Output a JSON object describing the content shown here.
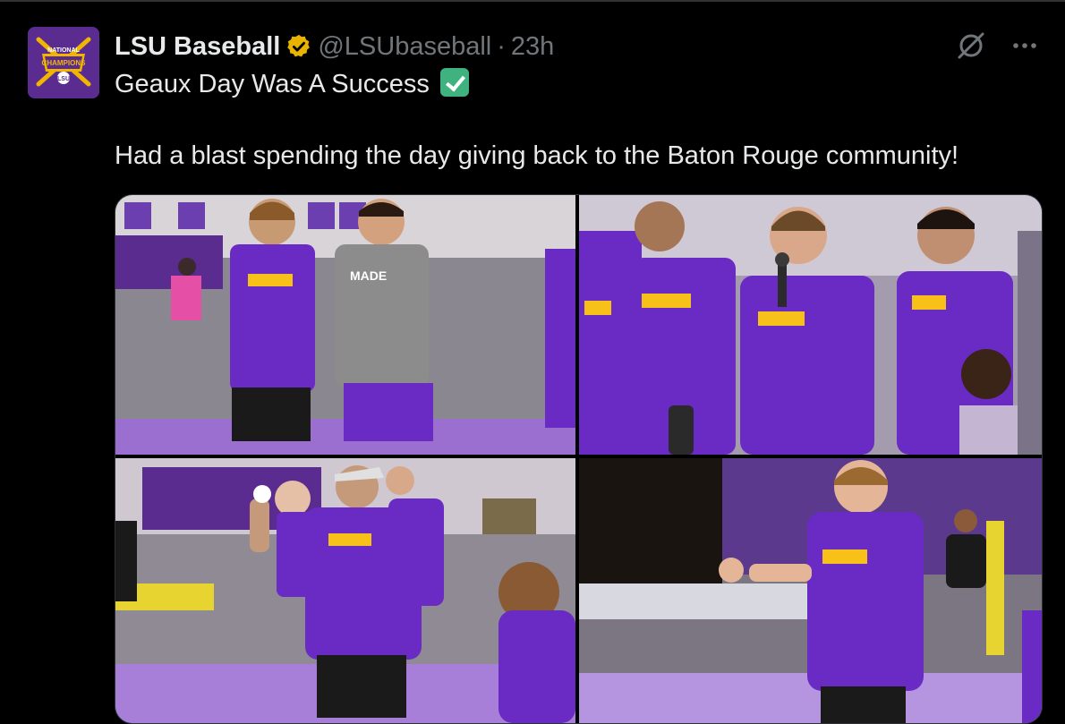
{
  "tweet": {
    "display_name": "LSU Baseball",
    "handle": "@LSUbaseball",
    "separator": "·",
    "time": "23h",
    "text_line1": "Geaux Day Was A Success",
    "text_emoji": "check-mark-button-emoji",
    "text_line2": "Had a blast spending the day giving back to the Baton Rouge community!",
    "avatar": {
      "badge_text": "NATIONAL",
      "badge_title": "CHAMPIONS",
      "bg_color": "#5b2c8f",
      "gold_color": "#f2b600"
    },
    "verified_color": "#e8b400",
    "media": [
      {
        "name": "photo-1",
        "desc_icon": "photo-players-smiling"
      },
      {
        "name": "photo-2",
        "desc_icon": "photo-player-microphone"
      },
      {
        "name": "photo-3",
        "desc_icon": "photo-player-throwing"
      },
      {
        "name": "photo-4",
        "desc_icon": "photo-player-pitching-drill"
      }
    ]
  },
  "colors": {
    "background": "#000000",
    "text_primary": "#e7e9ea",
    "text_secondary": "#71767b",
    "lsu_purple": "#6a2bc4",
    "lsu_gold": "#f7c11a"
  },
  "icons": {
    "grok": "grok-icon",
    "more": "more-dots-icon",
    "verified": "verified-badge-icon"
  }
}
